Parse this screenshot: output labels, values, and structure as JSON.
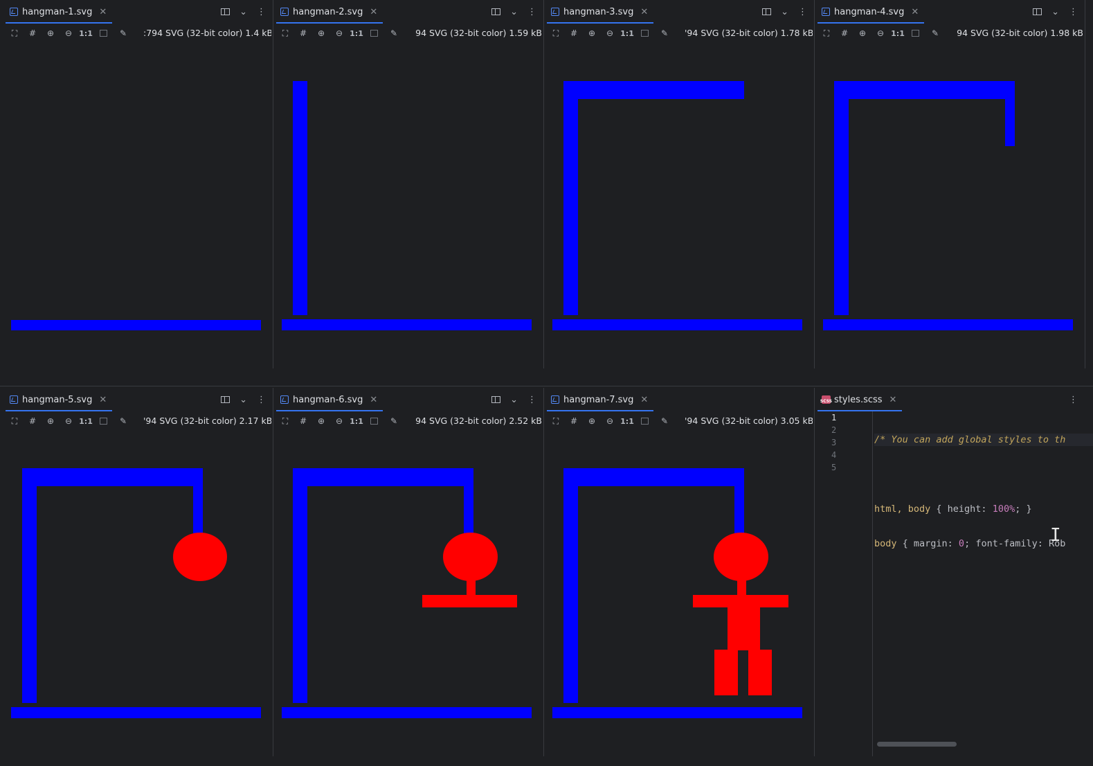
{
  "panes": [
    {
      "file": "hangman-1.svg",
      "info": ":794 SVG (32-bit color) 1.4 kB"
    },
    {
      "file": "hangman-2.svg",
      "info": "94 SVG (32-bit color) 1.59 kB"
    },
    {
      "file": "hangman-3.svg",
      "info": "'94 SVG (32-bit color) 1.78 kB"
    },
    {
      "file": "hangman-4.svg",
      "info": "94 SVG (32-bit color) 1.98 kB"
    },
    {
      "file": "hangman-5.svg",
      "info": "'94 SVG (32-bit color) 2.17 kB"
    },
    {
      "file": "hangman-6.svg",
      "info": "94 SVG (32-bit color) 2.52 kB"
    },
    {
      "file": "hangman-7.svg",
      "info": "'94 SVG (32-bit color) 3.05 kB"
    }
  ],
  "toolbar": {
    "fit_icon": "fit-screen-icon",
    "grid_icon": "grid-icon",
    "zoom_in_icon": "zoom-in-icon",
    "zoom_out_icon": "zoom-out-icon",
    "actual_size_label": "1:1",
    "background_icon": "background-icon",
    "color_picker_icon": "color-picker-icon"
  },
  "editor": {
    "file": "styles.scss",
    "line_numbers": [
      "1",
      "2",
      "3",
      "4",
      "5"
    ],
    "lines": {
      "l1_comment": "/* You can add global styles to th",
      "l3_selector": "html, body",
      "l3_rest1": " { height: ",
      "l3_num": "100%",
      "l3_rest2": "; }",
      "l4_selector": "body",
      "l4_rest1": " { margin: ",
      "l4_num": "0",
      "l4_rest2": "; font-family: Rob"
    }
  },
  "colors": {
    "gallows": "#0000ff",
    "figure": "#ff0000",
    "background": "#1e1f22",
    "tab_underline": "#3574f0"
  }
}
